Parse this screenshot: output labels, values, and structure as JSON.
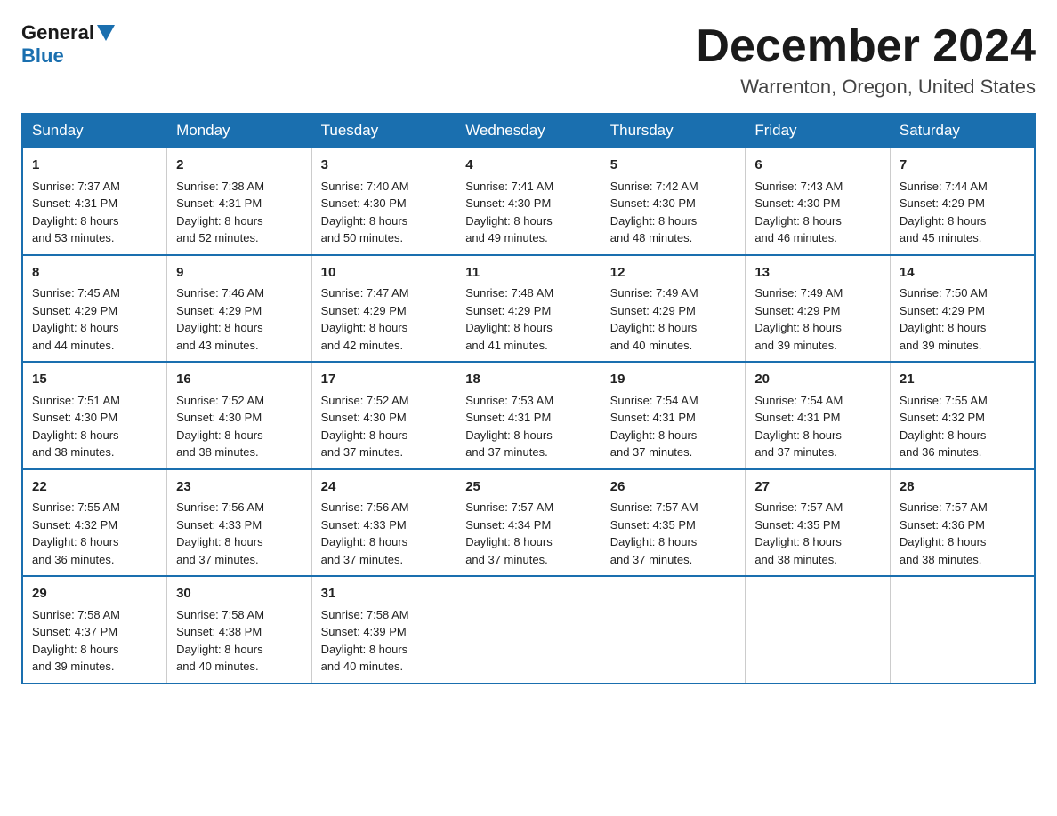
{
  "logo": {
    "general": "General",
    "blue": "Blue"
  },
  "title": "December 2024",
  "subtitle": "Warrenton, Oregon, United States",
  "days_header": [
    "Sunday",
    "Monday",
    "Tuesday",
    "Wednesday",
    "Thursday",
    "Friday",
    "Saturday"
  ],
  "weeks": [
    [
      {
        "day": "1",
        "sunrise": "7:37 AM",
        "sunset": "4:31 PM",
        "daylight": "8 hours and 53 minutes."
      },
      {
        "day": "2",
        "sunrise": "7:38 AM",
        "sunset": "4:31 PM",
        "daylight": "8 hours and 52 minutes."
      },
      {
        "day": "3",
        "sunrise": "7:40 AM",
        "sunset": "4:30 PM",
        "daylight": "8 hours and 50 minutes."
      },
      {
        "day": "4",
        "sunrise": "7:41 AM",
        "sunset": "4:30 PM",
        "daylight": "8 hours and 49 minutes."
      },
      {
        "day": "5",
        "sunrise": "7:42 AM",
        "sunset": "4:30 PM",
        "daylight": "8 hours and 48 minutes."
      },
      {
        "day": "6",
        "sunrise": "7:43 AM",
        "sunset": "4:30 PM",
        "daylight": "8 hours and 46 minutes."
      },
      {
        "day": "7",
        "sunrise": "7:44 AM",
        "sunset": "4:29 PM",
        "daylight": "8 hours and 45 minutes."
      }
    ],
    [
      {
        "day": "8",
        "sunrise": "7:45 AM",
        "sunset": "4:29 PM",
        "daylight": "8 hours and 44 minutes."
      },
      {
        "day": "9",
        "sunrise": "7:46 AM",
        "sunset": "4:29 PM",
        "daylight": "8 hours and 43 minutes."
      },
      {
        "day": "10",
        "sunrise": "7:47 AM",
        "sunset": "4:29 PM",
        "daylight": "8 hours and 42 minutes."
      },
      {
        "day": "11",
        "sunrise": "7:48 AM",
        "sunset": "4:29 PM",
        "daylight": "8 hours and 41 minutes."
      },
      {
        "day": "12",
        "sunrise": "7:49 AM",
        "sunset": "4:29 PM",
        "daylight": "8 hours and 40 minutes."
      },
      {
        "day": "13",
        "sunrise": "7:49 AM",
        "sunset": "4:29 PM",
        "daylight": "8 hours and 39 minutes."
      },
      {
        "day": "14",
        "sunrise": "7:50 AM",
        "sunset": "4:29 PM",
        "daylight": "8 hours and 39 minutes."
      }
    ],
    [
      {
        "day": "15",
        "sunrise": "7:51 AM",
        "sunset": "4:30 PM",
        "daylight": "8 hours and 38 minutes."
      },
      {
        "day": "16",
        "sunrise": "7:52 AM",
        "sunset": "4:30 PM",
        "daylight": "8 hours and 38 minutes."
      },
      {
        "day": "17",
        "sunrise": "7:52 AM",
        "sunset": "4:30 PM",
        "daylight": "8 hours and 37 minutes."
      },
      {
        "day": "18",
        "sunrise": "7:53 AM",
        "sunset": "4:31 PM",
        "daylight": "8 hours and 37 minutes."
      },
      {
        "day": "19",
        "sunrise": "7:54 AM",
        "sunset": "4:31 PM",
        "daylight": "8 hours and 37 minutes."
      },
      {
        "day": "20",
        "sunrise": "7:54 AM",
        "sunset": "4:31 PM",
        "daylight": "8 hours and 37 minutes."
      },
      {
        "day": "21",
        "sunrise": "7:55 AM",
        "sunset": "4:32 PM",
        "daylight": "8 hours and 36 minutes."
      }
    ],
    [
      {
        "day": "22",
        "sunrise": "7:55 AM",
        "sunset": "4:32 PM",
        "daylight": "8 hours and 36 minutes."
      },
      {
        "day": "23",
        "sunrise": "7:56 AM",
        "sunset": "4:33 PM",
        "daylight": "8 hours and 37 minutes."
      },
      {
        "day": "24",
        "sunrise": "7:56 AM",
        "sunset": "4:33 PM",
        "daylight": "8 hours and 37 minutes."
      },
      {
        "day": "25",
        "sunrise": "7:57 AM",
        "sunset": "4:34 PM",
        "daylight": "8 hours and 37 minutes."
      },
      {
        "day": "26",
        "sunrise": "7:57 AM",
        "sunset": "4:35 PM",
        "daylight": "8 hours and 37 minutes."
      },
      {
        "day": "27",
        "sunrise": "7:57 AM",
        "sunset": "4:35 PM",
        "daylight": "8 hours and 38 minutes."
      },
      {
        "day": "28",
        "sunrise": "7:57 AM",
        "sunset": "4:36 PM",
        "daylight": "8 hours and 38 minutes."
      }
    ],
    [
      {
        "day": "29",
        "sunrise": "7:58 AM",
        "sunset": "4:37 PM",
        "daylight": "8 hours and 39 minutes."
      },
      {
        "day": "30",
        "sunrise": "7:58 AM",
        "sunset": "4:38 PM",
        "daylight": "8 hours and 40 minutes."
      },
      {
        "day": "31",
        "sunrise": "7:58 AM",
        "sunset": "4:39 PM",
        "daylight": "8 hours and 40 minutes."
      },
      null,
      null,
      null,
      null
    ]
  ],
  "labels": {
    "sunrise": "Sunrise:",
    "sunset": "Sunset:",
    "daylight": "Daylight:"
  }
}
